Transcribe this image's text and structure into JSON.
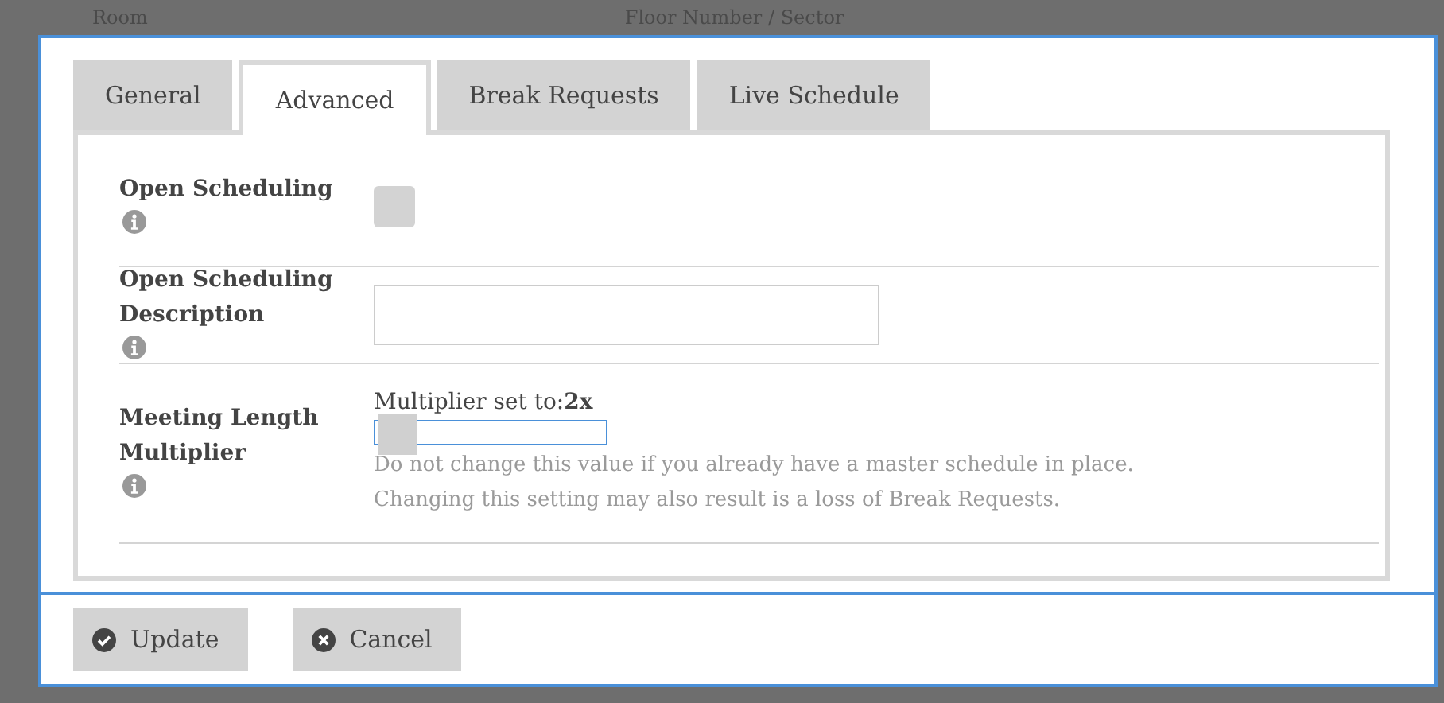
{
  "background": {
    "headers": [
      "Room",
      "Floor Number / Sector"
    ]
  },
  "tabs": [
    {
      "label": "General",
      "selected": false
    },
    {
      "label": "Advanced",
      "selected": true
    },
    {
      "label": "Break Requests",
      "selected": false
    },
    {
      "label": "Live Schedule",
      "selected": false
    }
  ],
  "fields": [
    {
      "kind": "checkbox",
      "label": "Open Scheduling",
      "checked": false
    },
    {
      "kind": "text",
      "label": "Open Scheduling Description"
    },
    {
      "kind": "slider",
      "label": "Meeting Length Multiplier",
      "caption": "Multiplier set to:",
      "reading": "2x",
      "level": 0,
      "help": [
        "Do not change this value if you already have a master schedule in place.",
        "Changing this setting may also result is a loss of Break Requests."
      ]
    }
  ],
  "buttons": [
    {
      "label": "Update",
      "kind": "confirm"
    },
    {
      "label": "Cancel",
      "kind": "cancel"
    }
  ]
}
